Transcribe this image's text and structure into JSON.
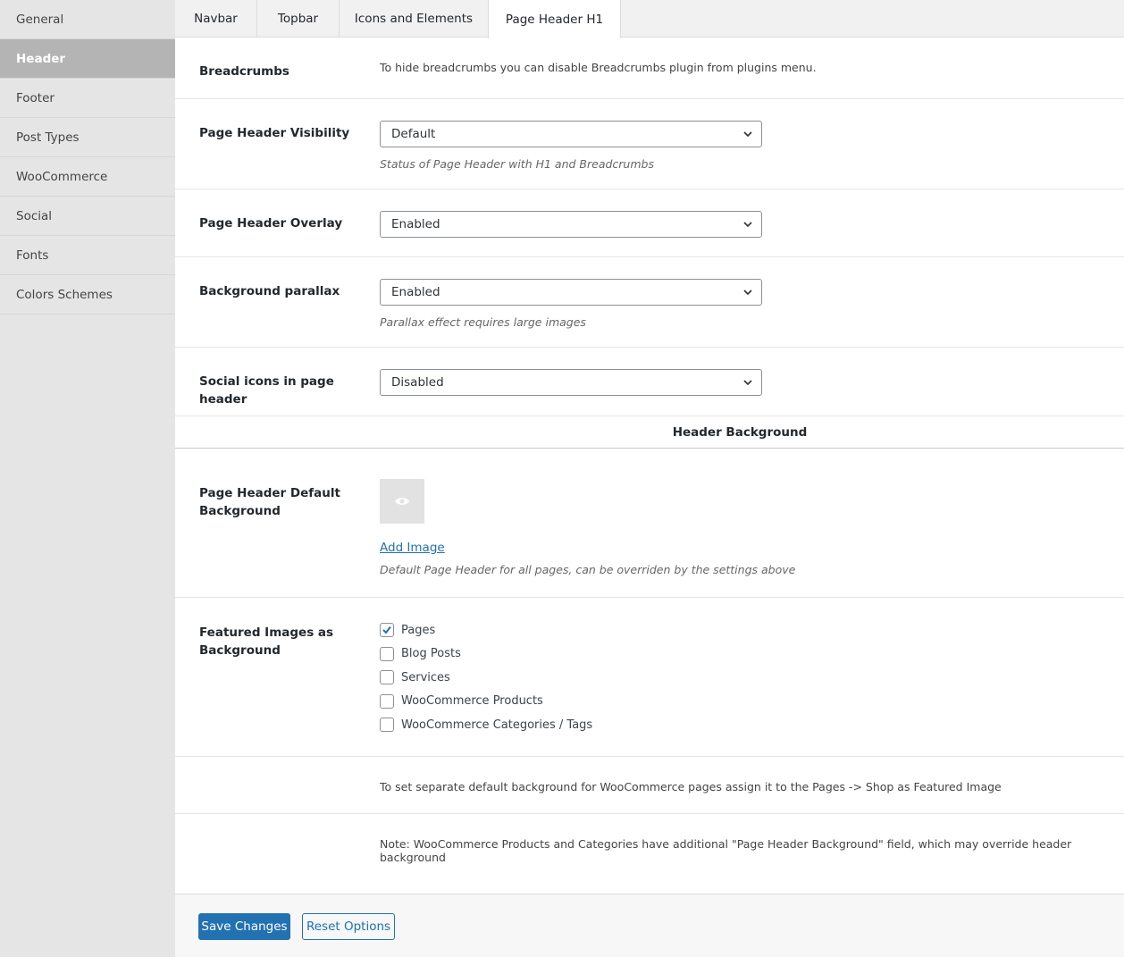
{
  "sidebar": {
    "items": [
      {
        "label": "General"
      },
      {
        "label": "Header",
        "active": true
      },
      {
        "label": "Footer"
      },
      {
        "label": "Post Types"
      },
      {
        "label": "WooCommerce"
      },
      {
        "label": "Social"
      },
      {
        "label": "Fonts"
      },
      {
        "label": "Colors Schemes"
      }
    ]
  },
  "tabs": [
    {
      "label": "Navbar"
    },
    {
      "label": "Topbar"
    },
    {
      "label": "Icons and Elements"
    },
    {
      "label": "Page Header H1",
      "active": true
    }
  ],
  "settings": {
    "breadcrumbs": {
      "label": "Breadcrumbs",
      "note": "To hide breadcrumbs you can disable Breadcrumbs plugin from plugins menu."
    },
    "visibility": {
      "label": "Page Header Visibility",
      "value": "Default",
      "desc": "Status of Page Header with H1 and Breadcrumbs"
    },
    "overlay": {
      "label": "Page Header Overlay",
      "value": "Enabled"
    },
    "parallax": {
      "label": "Background parallax",
      "value": "Enabled",
      "desc": "Parallax effect requires large images"
    },
    "social": {
      "label": "Social icons in page header",
      "value": "Disabled"
    },
    "section_title": "Header Background",
    "default_bg": {
      "label": "Page Header Default Background",
      "add_image": "Add Image",
      "desc": "Default Page Header for all pages, can be overriden by the settings above"
    },
    "featured": {
      "label": "Featured Images as Background",
      "options": [
        {
          "label": "Pages",
          "checked": true
        },
        {
          "label": "Blog Posts",
          "checked": false
        },
        {
          "label": "Services",
          "checked": false
        },
        {
          "label": "WooCommerce Products",
          "checked": false
        },
        {
          "label": "WooCommerce Categories / Tags",
          "checked": false
        }
      ]
    },
    "shop_note": "To set separate default background for WooCommerce pages assign it to the Pages -> Shop as Featured Image",
    "woo_note": "Note: WooCommerce Products and Categories have additional \"Page Header Background\" field, which may override header background"
  },
  "buttons": {
    "save": "Save Changes",
    "reset": "Reset Options"
  },
  "colors": {
    "accent": "#2271b1",
    "sidebar_bg": "#e5e5e5",
    "sidebar_active": "#b4b4b4"
  }
}
